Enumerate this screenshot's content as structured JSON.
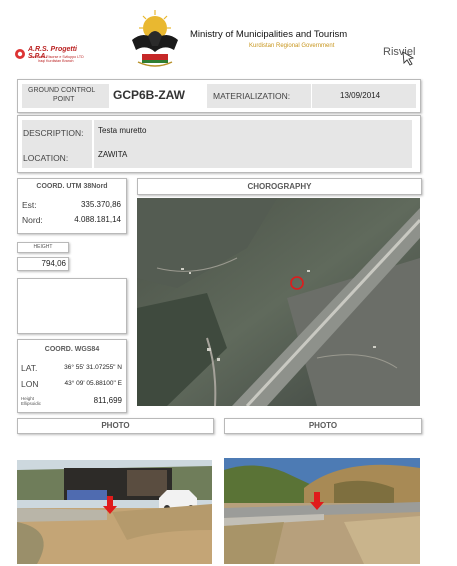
{
  "header": {
    "ministry": "Ministry of Municipalities and Tourism",
    "government": "Kurdistan Regional Government",
    "ars_name": "A.R.S. Progetti S.P.A.",
    "ars_line1": "Ambiente Risorse e Sviluppo LTD",
    "ars_line2": "Iraqi Kurdistan Branch",
    "risviel": "Risviel"
  },
  "gcp": {
    "label_line1": "GROUND CONTROL",
    "label_line2": "POINT",
    "code": "GCP6B-ZAW",
    "materialization_label": "MATERIALIZATION:",
    "materialization_date": "13/09/2014"
  },
  "info": {
    "description_label": "DESCRIPTION:",
    "description_value": "Testa muretto",
    "location_label": "LOCATION:",
    "location_value": "ZAWITA"
  },
  "utm": {
    "title": "COORD. UTM 38Nord",
    "est_label": "Est:",
    "est_value": "335.370,86",
    "nord_label": "Nord:",
    "nord_value": "4.088.181,14"
  },
  "height": {
    "label": "HEIGHT",
    "value": "794,06"
  },
  "wgs": {
    "title": "COORD. WGS84",
    "lat_label": "LAT.",
    "lat_value": "36° 55' 31.07255\" N",
    "lon_label": "LON",
    "lon_value": "43° 09' 05.88100\" E",
    "height_label_1": "Height",
    "height_label_2": "Ellipsoidic",
    "height_value": "811,699"
  },
  "chorography": {
    "title": "CHOROGRAPHY"
  },
  "photos": [
    {
      "title": "PHOTO"
    },
    {
      "title": "PHOTO"
    }
  ],
  "colors": {
    "label_gray": "#e6e6e6",
    "gold": "#c8961e",
    "marker_red": "#e01b1b"
  }
}
